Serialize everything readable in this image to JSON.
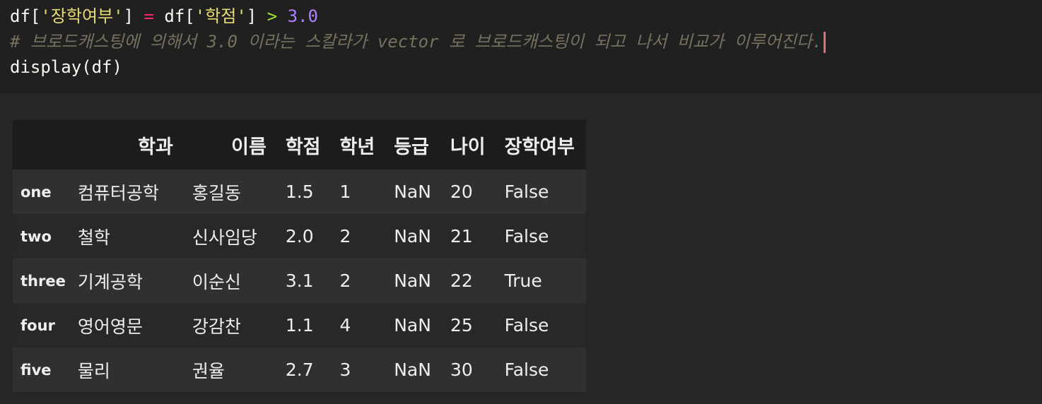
{
  "code": {
    "line1": {
      "p1": "df[",
      "s1": "'장학여부'",
      "p2": "] ",
      "op": "=",
      "p3": " df[",
      "s2": "'학점'",
      "p4": "] ",
      "gt": ">",
      "p5": " ",
      "num": "3.0"
    },
    "line2": "# 브로드캐스팅에 의해서 3.0 이라는 스칼라가 vector 로 브로드캐스팅이 되고 나서 비교가 이루어진다.",
    "line3": "display(df)"
  },
  "table": {
    "headers": [
      "",
      "학과",
      "이름",
      "학점",
      "학년",
      "등급",
      "나이",
      "장학여부"
    ],
    "rows": [
      {
        "index": "one",
        "학과": "컴퓨터공학",
        "이름": "홍길동",
        "학점": "1.5",
        "학년": "1",
        "등급": "NaN",
        "나이": "20",
        "장학여부": "False"
      },
      {
        "index": "two",
        "학과": "철학",
        "이름": "신사임당",
        "학점": "2.0",
        "학년": "2",
        "등급": "NaN",
        "나이": "21",
        "장학여부": "False"
      },
      {
        "index": "three",
        "학과": "기계공학",
        "이름": "이순신",
        "학점": "3.1",
        "학년": "2",
        "등급": "NaN",
        "나이": "22",
        "장학여부": "True"
      },
      {
        "index": "four",
        "학과": "영어영문",
        "이름": "강감찬",
        "학점": "1.1",
        "학년": "4",
        "등급": "NaN",
        "나이": "25",
        "장학여부": "False"
      },
      {
        "index": "five",
        "학과": "물리",
        "이름": "권율",
        "학점": "2.7",
        "학년": "3",
        "등급": "NaN",
        "나이": "30",
        "장학여부": "False"
      }
    ]
  },
  "colors": {
    "string": "#e6db74",
    "operator": "#f92672",
    "number": "#ae81ff",
    "comment": "#75715e",
    "cursor": "#e06c75"
  }
}
